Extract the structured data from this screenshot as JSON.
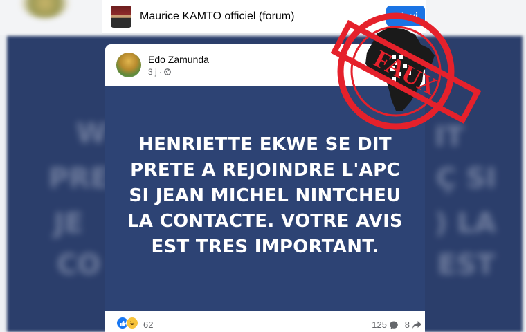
{
  "group": {
    "name": "Maurice KAMTO officiel (forum)",
    "invite_label": "+ Invi"
  },
  "post": {
    "author": "Edo Zamunda",
    "time": "3 j ·",
    "image_text": "HENRIETTE EKWE SE DIT PRETE A REJOINDRE L'APC SI JEAN MICHEL NINTCHEU LA CONTACTE. VOTRE AVIS EST TRES IMPORTANT.",
    "reaction_count": "62",
    "comment_count": "125",
    "share_count": "8"
  },
  "stamp": {
    "label": "FAUX",
    "color": "#e5212b"
  },
  "colors": {
    "post_image_bg": "#2d4374",
    "facebook_blue": "#1b74e4"
  }
}
